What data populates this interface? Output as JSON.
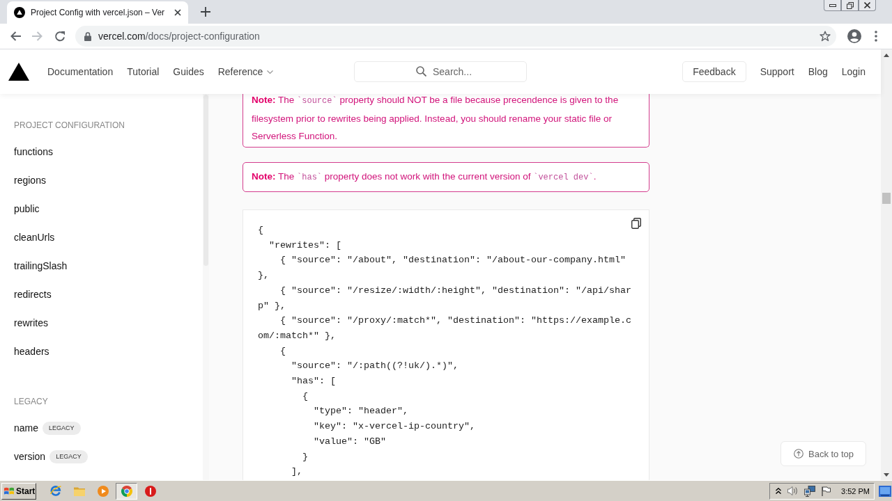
{
  "browser": {
    "tabs": [
      {
        "title": "Project Config with vercel.json – Ver",
        "selected": true
      }
    ],
    "nav_buttons": [
      {
        "kind": "back",
        "disabled": false
      },
      {
        "kind": "forward",
        "disabled": true
      },
      {
        "kind": "reload",
        "disabled": false
      }
    ],
    "address": {
      "host": "vercel.com",
      "path": "/docs/project-configuration"
    }
  },
  "site_header": {
    "nav": [
      {
        "label": "Documentation",
        "dropdown": false
      },
      {
        "label": "Tutorial",
        "dropdown": false
      },
      {
        "label": "Guides",
        "dropdown": false
      },
      {
        "label": "Reference",
        "dropdown": true
      }
    ],
    "search": {
      "placeholder": "Search..."
    },
    "actions": [
      {
        "label": "Feedback",
        "kind": "button"
      },
      {
        "label": "Support",
        "kind": "link"
      },
      {
        "label": "Blog",
        "kind": "link"
      },
      {
        "label": "Login",
        "kind": "link"
      }
    ]
  },
  "sidebar": {
    "sections": [
      {
        "heading": "PROJECT CONFIGURATION",
        "items": [
          {
            "label": "functions",
            "selected": false
          },
          {
            "label": "regions",
            "selected": false
          },
          {
            "label": "public",
            "selected": false
          },
          {
            "label": "cleanUrls",
            "selected": false
          },
          {
            "label": "trailingSlash",
            "selected": false
          },
          {
            "label": "redirects",
            "selected": false
          },
          {
            "label": "rewrites",
            "selected": false
          },
          {
            "label": "headers",
            "selected": false
          }
        ]
      },
      {
        "heading": "LEGACY",
        "items": [
          {
            "label": "name",
            "badge": "LEGACY",
            "selected": false
          },
          {
            "label": "version",
            "badge": "LEGACY",
            "selected": false
          }
        ]
      }
    ]
  },
  "notes": [
    {
      "segments": [
        {
          "kind": "strong",
          "text": "Note:"
        },
        {
          "kind": "text",
          "text": " The "
        },
        {
          "kind": "code",
          "text": "`source`"
        },
        {
          "kind": "text",
          "text": " property should NOT be a file because precendence is given to the filesystem prior to rewrites being applied. Instead, you should rename your static file or Serverless Function."
        }
      ]
    },
    {
      "segments": [
        {
          "kind": "strong",
          "text": "Note:"
        },
        {
          "kind": "text",
          "text": " The "
        },
        {
          "kind": "code",
          "text": "`has`"
        },
        {
          "kind": "text",
          "text": " property does not work with the current version of "
        },
        {
          "kind": "code",
          "text": "`vercel dev`"
        },
        {
          "kind": "text",
          "text": "."
        }
      ]
    }
  ],
  "code_block": {
    "lines": [
      "{",
      "  \"rewrites\": [",
      "    { \"source\": \"/about\", \"destination\": \"/about-our-company.html\"",
      "},",
      "    { \"source\": \"/resize/:width/:height\", \"destination\": \"/api/shar",
      "p\" },",
      "    { \"source\": \"/proxy/:match*\", \"destination\": \"https://example.c",
      "om/:match*\" },",
      "    {",
      "      \"source\": \"/:path((?!uk/).*)\",",
      "      \"has\": [",
      "        {",
      "          \"type\": \"header\",",
      "          \"key\": \"x-vercel-ip-country\",",
      "          \"value\": \"GB\"",
      "        }",
      "      ],"
    ]
  },
  "back_to_top": {
    "label": "Back to top"
  },
  "taskbar": {
    "start": "Start",
    "apps": [
      {
        "kind": "ie",
        "selected": false
      },
      {
        "kind": "folder",
        "selected": false
      },
      {
        "kind": "media",
        "selected": false
      },
      {
        "kind": "chrome",
        "selected": true
      },
      {
        "kind": "alert",
        "selected": false
      }
    ],
    "clock": "3:52 PM"
  }
}
